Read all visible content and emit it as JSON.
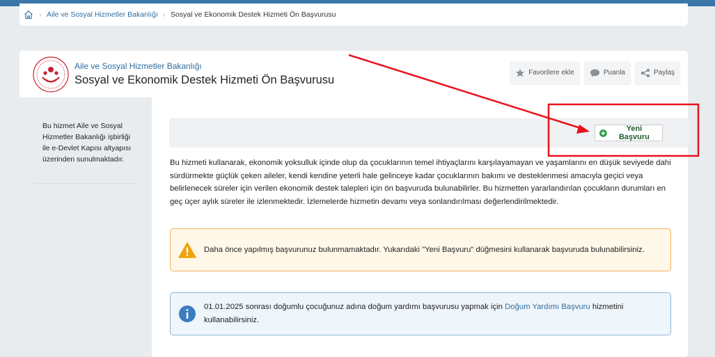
{
  "breadcrumb": {
    "home_icon": "home-icon",
    "items": [
      "Aile ve Sosyal Hizmetler Bakanlığı",
      "Sosyal ve Ekonomik Destek Hizmeti Ön Başvurusu"
    ]
  },
  "service": {
    "ministry": "Aile ve Sosyal Hizmetler Bakanlığı",
    "title": "Sosyal ve Ekonomik Destek Hizmeti Ön Başvurusu"
  },
  "actions": {
    "favorite": "Favorilere ekle",
    "rate": "Puanla",
    "share": "Paylaş"
  },
  "sidebar": {
    "text": "Bu hizmet Aile ve Sosyal Hizmetler Bakanlığı işbirliği ile e-Devlet Kapısı altyapısı üzerinden sunulmaktadır."
  },
  "main": {
    "new_application": "Yeni Başvuru",
    "description": "Bu hizmeti kullanarak, ekonomik yoksulluk içinde olup da çocuklarının temel ihtiyaçlarını karşılayamayan ve yaşamlarını en düşük seviyede dahi sürdürmekte güçlük çeken aileler, kendi kendine yeterli hale gelinceye kadar çocuklarının bakımı ve desteklenmesi amacıyla geçici veya belirlenecek süreler için verilen ekonomik destek talepleri için ön başvuruda bulunabilirler. Bu hizmetten yararlandırılan çocukların durumları en geç üçer aylık süreler ile izlenmektedir. İzlemelerde hizmetin devamı veya sonlandırılması değerlendirilmektedir.",
    "warning": "Daha önce yapılmış başvurunuz bulunmamaktadır. Yukarıdaki \"Yeni Başvuru\" düğmesini kullanarak başvuruda bulunabilirsiniz.",
    "info_before": "01.01.2025 sonrası doğumlu çocuğunuz adına doğum yardımı başvurusu yapmak için ",
    "info_link": "Doğum Yardımı Başvuru",
    "info_after": " hizmetini kullanabilirsiniz."
  },
  "colors": {
    "topbar": "#3a76a8",
    "link": "#2f6d9f",
    "annotation": "#e8121b",
    "warning_border": "#f3b35a",
    "info_border": "#8eb3d3",
    "new_button_icon": "#2e9a4a"
  }
}
